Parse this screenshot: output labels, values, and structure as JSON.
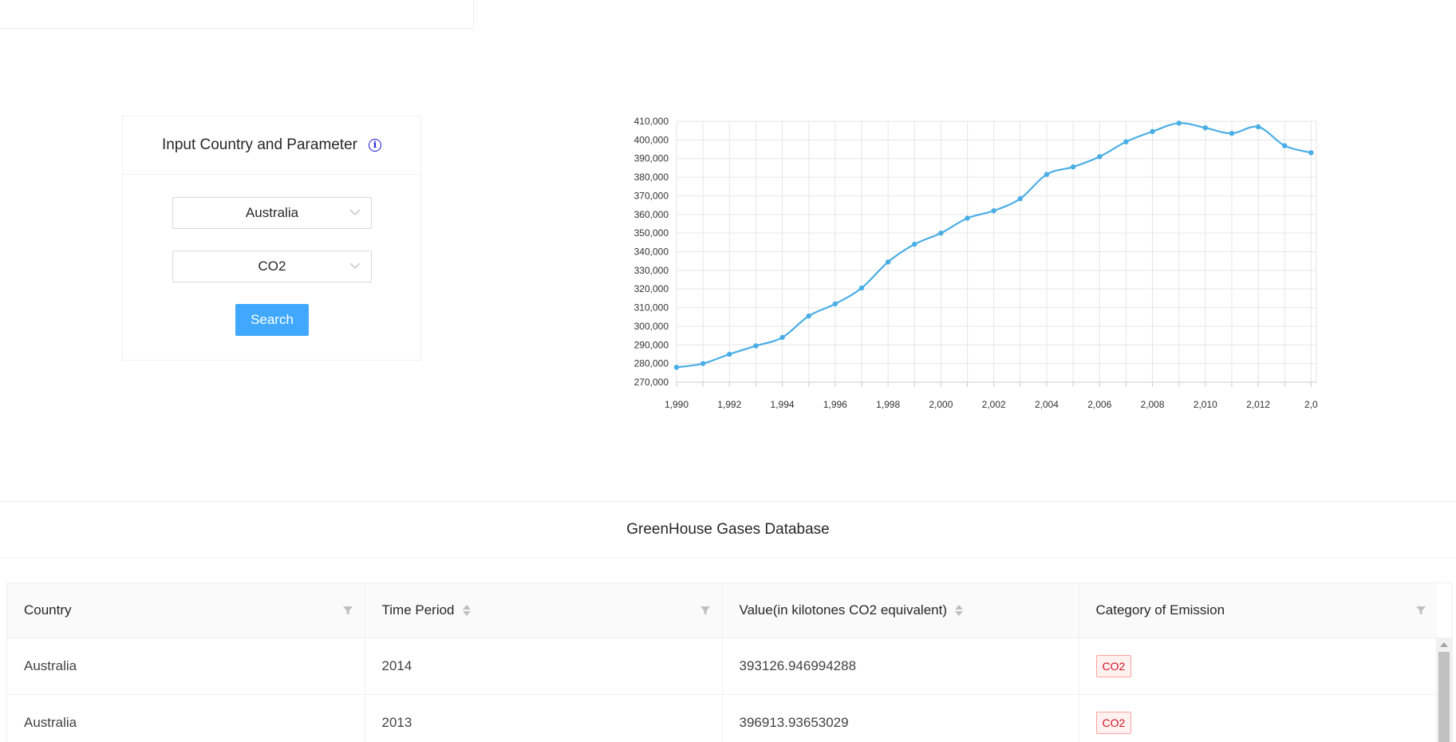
{
  "form": {
    "title": "Input Country and Parameter",
    "country_select": "Australia",
    "parameter_select": "CO2",
    "search_label": "Search"
  },
  "chart_data": {
    "type": "line",
    "title": "",
    "xlabel": "",
    "ylabel": "",
    "x": [
      1990,
      1991,
      1992,
      1993,
      1994,
      1995,
      1996,
      1997,
      1998,
      1999,
      2000,
      2001,
      2002,
      2003,
      2004,
      2005,
      2006,
      2007,
      2008,
      2009,
      2010,
      2011,
      2012,
      2013,
      2014
    ],
    "series": [
      {
        "values": [
          278000,
          280000,
          285000,
          289500,
          294000,
          305500,
          312000,
          320500,
          334500,
          344000,
          350000,
          358000,
          362000,
          368500,
          381500,
          385500,
          391000,
          399000,
          404500,
          409000,
          406500,
          403500,
          407000,
          396913.93653029,
          393126.946994288
        ]
      }
    ],
    "x_ticks": [
      "1,990",
      "1,992",
      "1,994",
      "1,996",
      "1,998",
      "2,000",
      "2,002",
      "2,004",
      "2,006",
      "2,008",
      "2,010",
      "2,012",
      "2,0"
    ],
    "y_ticks": [
      "410,000",
      "400,000",
      "390,000",
      "380,000",
      "370,000",
      "360,000",
      "350,000",
      "340,000",
      "330,000",
      "320,000",
      "310,000",
      "300,000",
      "290,000",
      "280,000",
      "270,000"
    ],
    "ylim": [
      270000,
      410000
    ],
    "grid": true,
    "line_color": "#4aaee5"
  },
  "table": {
    "title": "GreenHouse Gases Database",
    "columns": [
      "Country",
      "Time Period",
      "Value(in kilotones CO2 equivalent)",
      "Category of Emission"
    ],
    "rows": [
      [
        "Australia",
        "2014",
        "393126.946994288",
        "CO2"
      ],
      [
        "Australia",
        "2013",
        "396913.93653029",
        "CO2"
      ]
    ]
  }
}
